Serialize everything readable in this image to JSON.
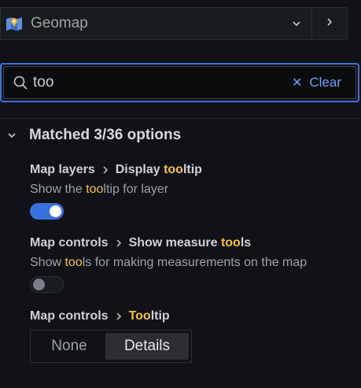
{
  "viz_picker": {
    "name": "Geomap",
    "icon": "map-icon"
  },
  "search": {
    "value": "too",
    "placeholder": "",
    "clear_label": "Clear"
  },
  "matched": {
    "title": "Matched 3/36 options"
  },
  "options": [
    {
      "path_parent": "Map layers",
      "title_pre": "Display ",
      "title_hl": "too",
      "title_post": "ltip",
      "desc_pre": "Show the ",
      "desc_hl": "too",
      "desc_post": "ltip for layer",
      "control": "switch",
      "enabled": true
    },
    {
      "path_parent": "Map controls",
      "title_pre": "Show measure ",
      "title_hl": "too",
      "title_post": "ls",
      "desc_pre": "Show ",
      "desc_hl": "too",
      "desc_post": "ls for making measurements on the map",
      "control": "switch",
      "enabled": false
    },
    {
      "path_parent": "Map controls",
      "title_pre": "",
      "title_hl": "Too",
      "title_post": "ltip",
      "control": "radio",
      "radio_options": [
        "None",
        "Details"
      ],
      "selected": "Details"
    }
  ],
  "colors": {
    "accent": "#3d71d9",
    "highlight": "#f5c04a",
    "link": "#6e9fff",
    "background": "#111217"
  }
}
